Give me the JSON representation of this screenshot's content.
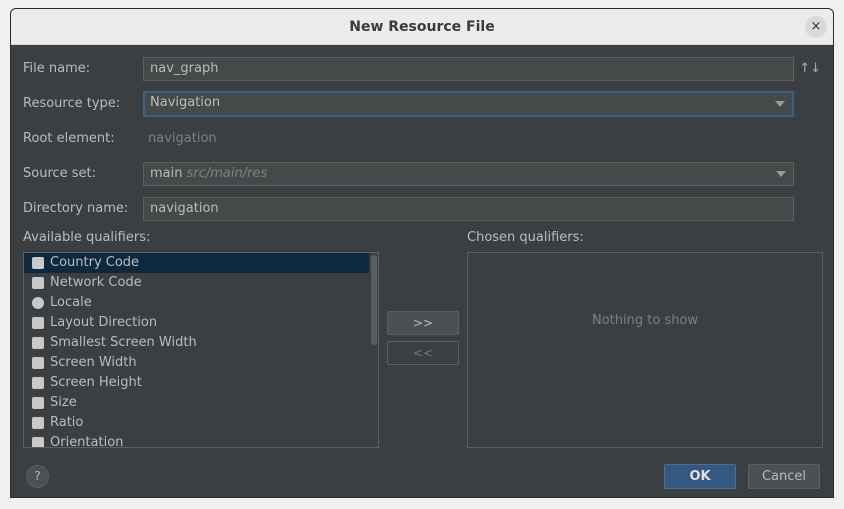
{
  "window": {
    "title": "New Resource File",
    "close_icon": "×"
  },
  "form": {
    "file_name_label": "File name:",
    "file_name_value": "nav_graph",
    "resource_type_label": "Resource type:",
    "resource_type_value": "Navigation",
    "root_element_label": "Root element:",
    "root_element_value": "navigation",
    "source_set_label": "Source set:",
    "source_set_value": "main",
    "source_set_path": "src/main/res",
    "directory_name_label": "Directory name:",
    "directory_name_value": "navigation",
    "sort_icon": "↑↓"
  },
  "qualifiers": {
    "available_label": "Available qualifiers:",
    "chosen_label": "Chosen qualifiers:",
    "items": [
      {
        "label": "Country Code"
      },
      {
        "label": "Network Code"
      },
      {
        "label": "Locale"
      },
      {
        "label": "Layout Direction"
      },
      {
        "label": "Smallest Screen Width"
      },
      {
        "label": "Screen Width"
      },
      {
        "label": "Screen Height"
      },
      {
        "label": "Size"
      },
      {
        "label": "Ratio"
      },
      {
        "label": "Orientation"
      }
    ],
    "add_label": ">>",
    "remove_label": "<<",
    "empty_text": "Nothing to show"
  },
  "buttons": {
    "help_label": "?",
    "ok_label": "OK",
    "cancel_label": "Cancel"
  }
}
